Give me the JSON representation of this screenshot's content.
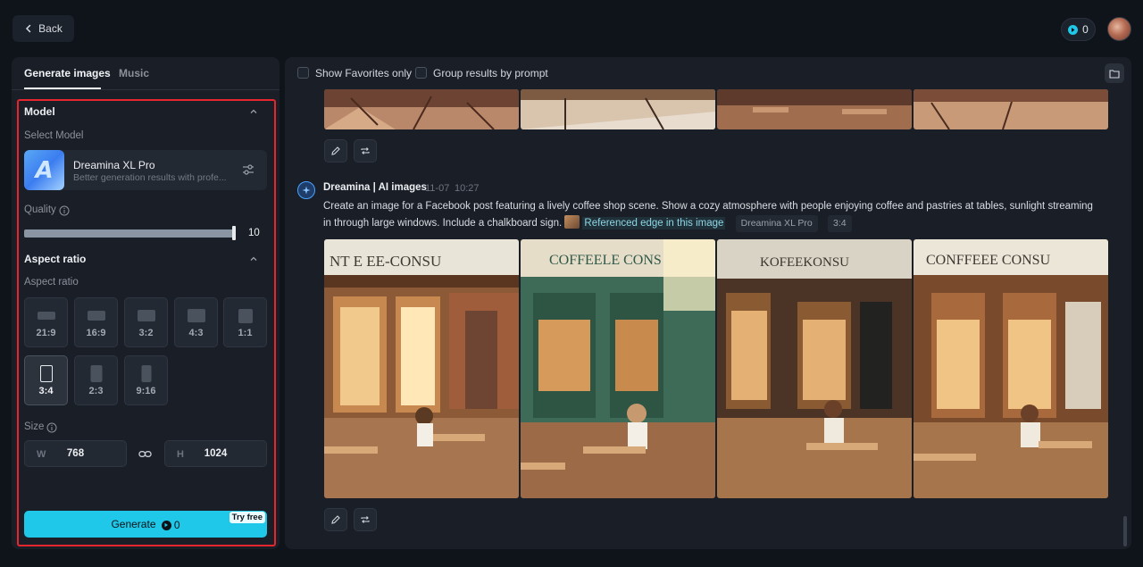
{
  "header": {
    "back_label": "Back",
    "credits": "0"
  },
  "left": {
    "tabs": [
      "Generate images",
      "Music"
    ],
    "model_section": {
      "title": "Model",
      "select_label": "Select Model",
      "model_name": "Dreamina XL Pro",
      "model_desc": "Better generation results with profe..."
    },
    "quality": {
      "label": "Quality",
      "value": "10",
      "fraction": 1.0
    },
    "aspect_section": {
      "title": "Aspect ratio",
      "sub_label": "Aspect ratio",
      "ratios": [
        "21:9",
        "16:9",
        "3:2",
        "4:3",
        "1:1",
        "3:4",
        "2:3",
        "9:16"
      ],
      "selected": "3:4"
    },
    "size": {
      "label": "Size",
      "w_prefix": "W",
      "w_value": "768",
      "h_prefix": "H",
      "h_value": "1024"
    },
    "generate": {
      "label": "Generate",
      "cost": "0",
      "badge": "Try free"
    }
  },
  "right": {
    "show_favorites": "Show Favorites only",
    "group_results": "Group results by prompt",
    "message": {
      "author": "Dreamina | AI images",
      "date": "11-07",
      "time": "10:27",
      "prompt": "Create an image for a Facebook post featuring a lively coffee shop scene. Show a cozy atmosphere with people enjoying coffee and pastries at tables, sunlight streaming in through large windows. Include a chalkboard sign.",
      "reference": "Referenced edge in this image",
      "model_tag": "Dreamina XL Pro",
      "ratio_tag": "3:4"
    },
    "signs": [
      "NT E EE-CONSU",
      "COFFEELE CONS",
      "KOFEEKONSU",
      "CONFFEEE CONSU"
    ]
  },
  "colors": {
    "accent": "#1fc8e8",
    "highlight": "#e5262f",
    "panel": "#1a1f27",
    "background": "#0f131a"
  }
}
